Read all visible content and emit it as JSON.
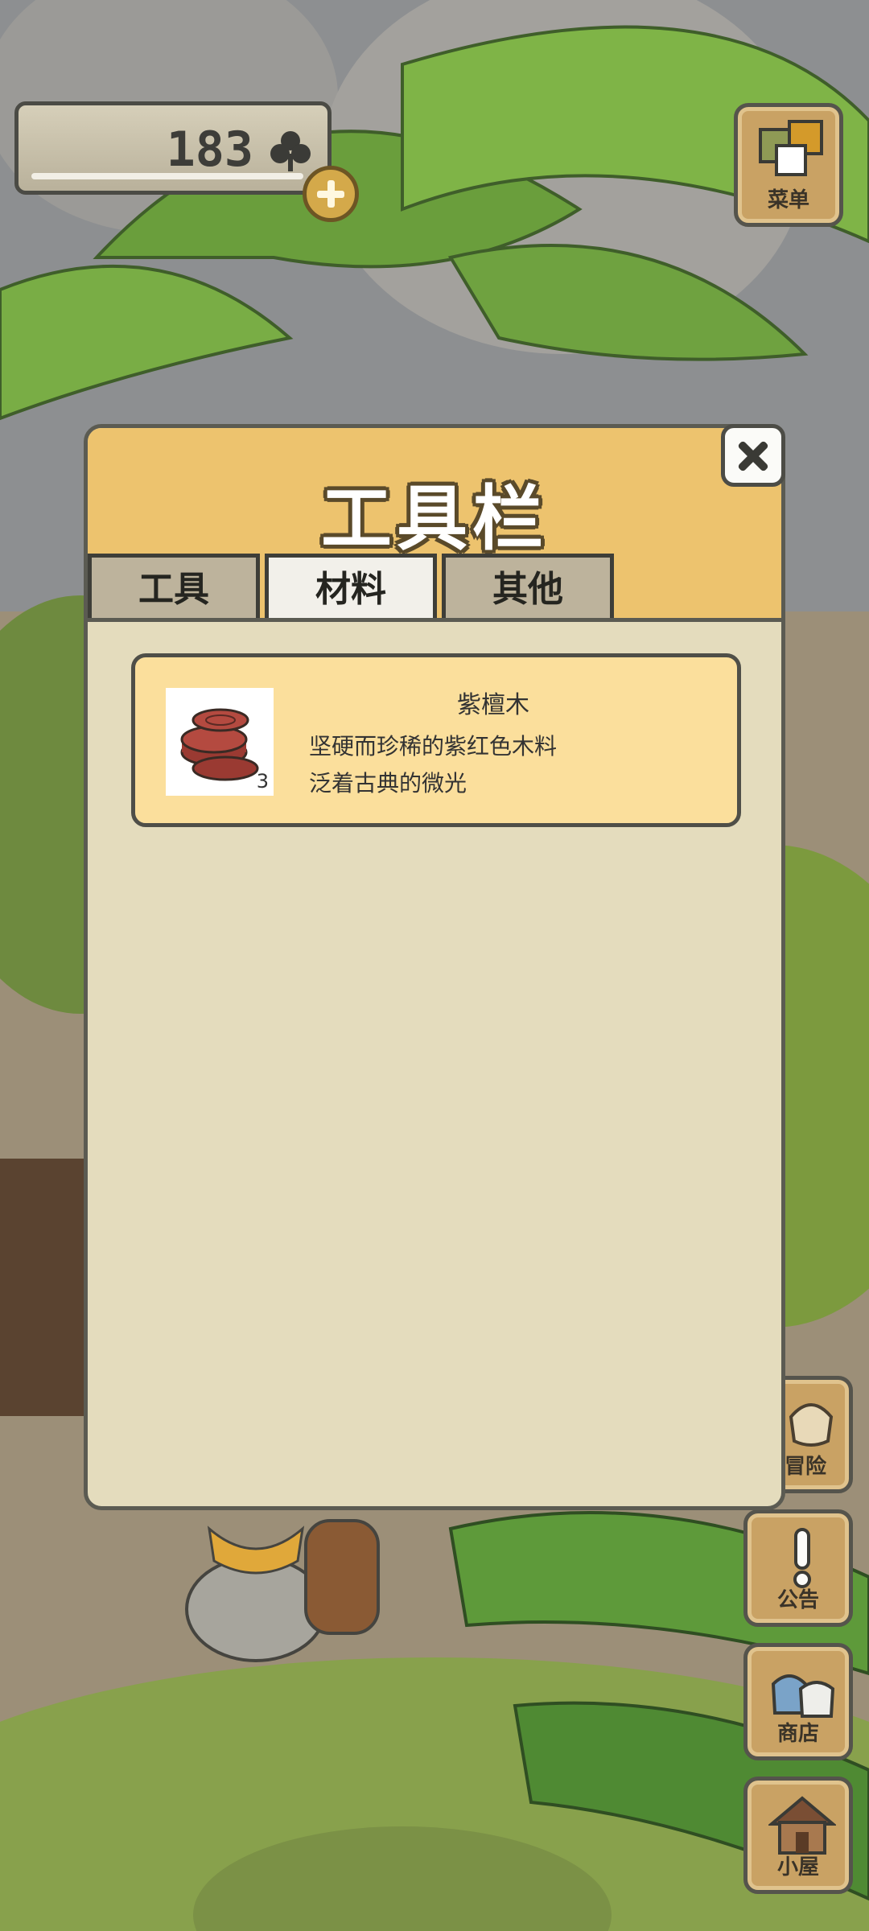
{
  "currency": {
    "amount": "183",
    "icon": "clover-icon"
  },
  "menu": {
    "label": "菜单"
  },
  "dialog": {
    "title": "工具栏",
    "tabs": [
      {
        "label": "工具"
      },
      {
        "label": "材料"
      },
      {
        "label": "其他"
      }
    ],
    "active_tab": "材料",
    "items": [
      {
        "name": "紫檀木",
        "count": "3",
        "description_line1": "坚硬而珍稀的紫红色木料",
        "description_line2": "泛着古典的微光"
      }
    ]
  },
  "side_buttons": [
    {
      "label": "冒险",
      "icon": "bag-icon"
    },
    {
      "label": "公告",
      "icon": "exclamation-icon"
    },
    {
      "label": "商店",
      "icon": "shop-bags-icon"
    },
    {
      "label": "小屋",
      "icon": "house-icon"
    }
  ],
  "colors": {
    "dialog_header": "#edc36e",
    "dialog_body": "#e4dcbd",
    "item_card": "#fbdf9c"
  }
}
